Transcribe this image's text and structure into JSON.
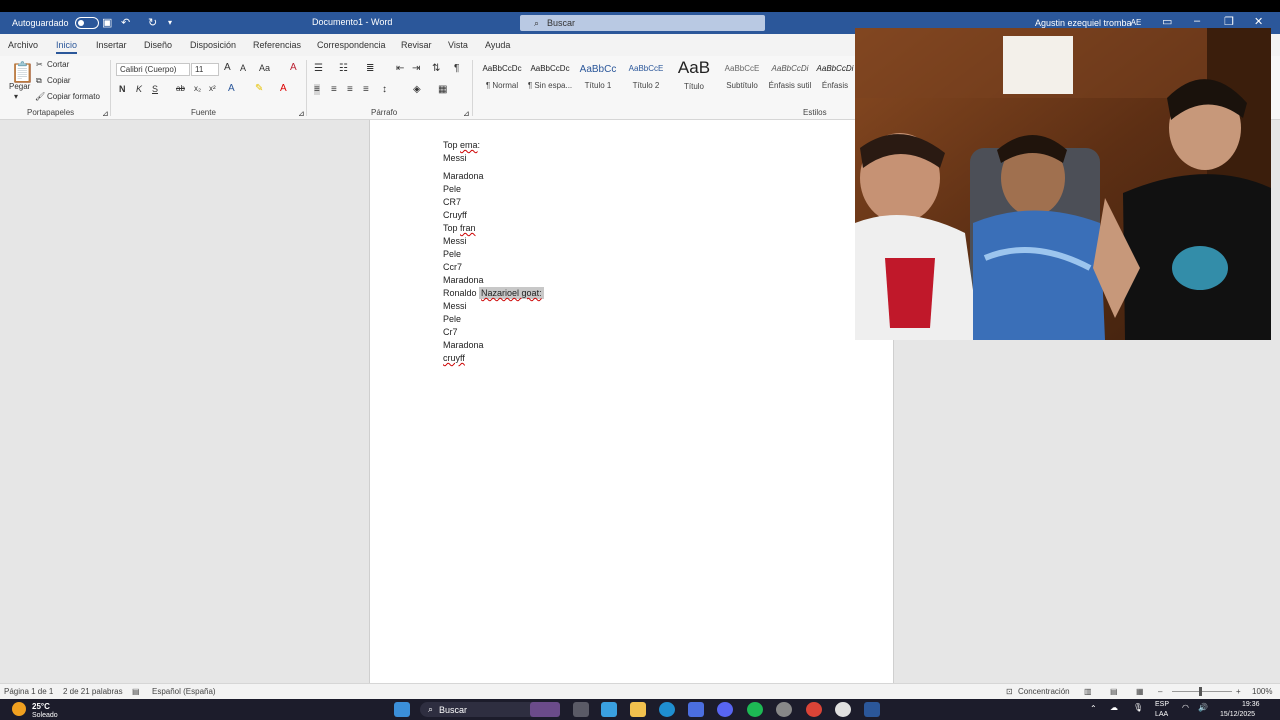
{
  "titlebar": {
    "autosave_label": "Autoguardado",
    "doc_title": "Documento1 - Word",
    "search_placeholder": "Buscar",
    "user_name": "Agustin ezequiel tromba",
    "user_initials": "AE"
  },
  "tabs": [
    "Archivo",
    "Inicio",
    "Insertar",
    "Diseño",
    "Disposición",
    "Referencias",
    "Correspondencia",
    "Revisar",
    "Vista",
    "Ayuda"
  ],
  "ribbon": {
    "clipboard": {
      "paste": "Pegar",
      "cut": "Cortar",
      "copy": "Copiar",
      "format_painter": "Copiar formato",
      "group": "Portapapeles"
    },
    "font": {
      "family": "Calibri (Cuerpo)",
      "size": "11",
      "bold": "N",
      "italic": "K",
      "underline": "S",
      "group": "Fuente"
    },
    "paragraph": {
      "group": "Párrafo"
    },
    "styles": {
      "group": "Estilos",
      "items": [
        {
          "sample": "AaBbCcDc",
          "name": "¶ Normal"
        },
        {
          "sample": "AaBbCcDc",
          "name": "¶ Sin espa..."
        },
        {
          "sample": "AaBbCc",
          "name": "Título 1"
        },
        {
          "sample": "AaBbCcE",
          "name": "Título 2"
        },
        {
          "sample": "AaB",
          "name": "Título"
        },
        {
          "sample": "AaBbCcE",
          "name": "Subtítulo"
        },
        {
          "sample": "AaBbCcDi",
          "name": "Énfasis sutil"
        },
        {
          "sample": "AaBbCcDi",
          "name": "Énfasis"
        }
      ]
    }
  },
  "document": {
    "lines": [
      {
        "pre": "Top ",
        "mark": "ema",
        "post": ":"
      },
      {
        "pre": "Messi",
        "mark": "",
        "post": ""
      },
      {
        "pre": "Maradona",
        "mark": "",
        "post": ""
      },
      {
        "pre": "Pele",
        "mark": "",
        "post": ""
      },
      {
        "pre": "CR7",
        "mark": "",
        "post": ""
      },
      {
        "pre": "Cruyff",
        "mark": "",
        "post": ""
      },
      {
        "pre": "Top ",
        "mark": "fran",
        "post": ""
      },
      {
        "pre": "Messi",
        "mark": "",
        "post": ""
      },
      {
        "pre": "Pele",
        "mark": "",
        "post": ""
      },
      {
        "pre": "Ccr7",
        "mark": "",
        "post": ""
      },
      {
        "pre": "Maradona",
        "mark": "",
        "post": ""
      },
      {
        "pre": "Ronaldo ",
        "mark": "",
        "post": "",
        "highlight": "Nazarioel goat:"
      },
      {
        "pre": "Messi",
        "mark": "",
        "post": ""
      },
      {
        "pre": "Pele",
        "mark": "",
        "post": ""
      },
      {
        "pre": "Cr7",
        "mark": "",
        "post": ""
      },
      {
        "pre": "Maradona",
        "mark": "",
        "post": ""
      },
      {
        "pre": "",
        "mark": "cruyff",
        "post": ""
      }
    ]
  },
  "statusbar": {
    "page": "Página 1 de 1",
    "words": "2 de 21 palabras",
    "language": "Español (España)",
    "focus": "Concentración",
    "zoom": "100%"
  },
  "taskbar": {
    "weather_temp": "25°C",
    "weather_desc": "Soleado",
    "search": "Buscar",
    "lang_top": "ESP",
    "lang_bottom": "LAA",
    "time": "19:36",
    "date": "15/12/2025"
  }
}
